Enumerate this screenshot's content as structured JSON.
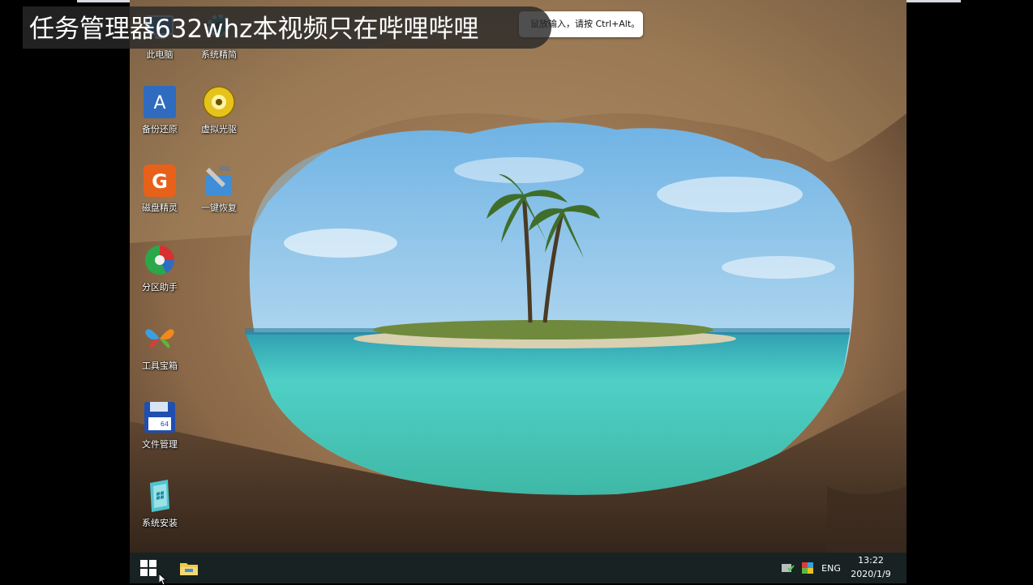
{
  "overlay": {
    "banner_text": "任务管理器632whz本视频只在哔哩哔哩",
    "tooltip_text": "鼠放输入，请按 Ctrl+Alt。"
  },
  "desktop": {
    "icons": [
      {
        "label": "此电脑",
        "icon": "computer-icon"
      },
      {
        "label": "系统精简",
        "icon": "gear-icon"
      },
      {
        "label": "备份还原",
        "icon": "backup-restore-icon"
      },
      {
        "label": "虚拟光驱",
        "icon": "virtual-cd-icon"
      },
      {
        "label": "磁盘精灵",
        "icon": "diskgenius-icon"
      },
      {
        "label": "一键恢复",
        "icon": "one-key-restore-icon"
      },
      {
        "label": "分区助手",
        "icon": "partition-assistant-icon"
      },
      {
        "label": "工具宝箱",
        "icon": "toolbox-icon"
      },
      {
        "label": "文件管理",
        "icon": "floppy-disk-icon"
      },
      {
        "label": "系统安装",
        "icon": "system-install-icon"
      }
    ]
  },
  "taskbar": {
    "start_icon": "windows-logo-icon",
    "pinned": [
      "file-explorer-icon"
    ],
    "tray": {
      "language": "ENG",
      "time": "13:22",
      "date": "2020/1/9"
    }
  },
  "colors": {
    "taskbar": "#14222488",
    "sky": "#8fc8ea",
    "sea": "#5fd3c7",
    "rock": "#7a5a3e"
  }
}
